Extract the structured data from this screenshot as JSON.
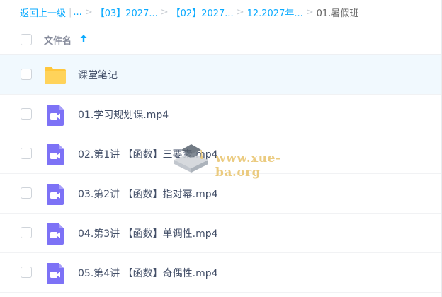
{
  "breadcrumb": {
    "back_label": "返回上一级",
    "separator_bar": "|",
    "ellipsis": "...",
    "chevron": ">",
    "items": [
      "【03】2027...",
      "【02】2027...",
      "12.2027年...",
      "01.暑假班"
    ]
  },
  "list": {
    "header_label": "文件名",
    "sort_icon": "arrow-up-icon",
    "files": [
      {
        "name": "课堂笔记",
        "icon": "folder-icon"
      },
      {
        "name": "01.学习规划课.mp4",
        "icon": "video-file-icon"
      },
      {
        "name": "02.第1讲 【函数】三要素.mp4",
        "icon": "video-file-icon"
      },
      {
        "name": "03.第2讲 【函数】指对幂.mp4",
        "icon": "video-file-icon"
      },
      {
        "name": "04.第3讲 【函数】单调性.mp4",
        "icon": "video-file-icon"
      },
      {
        "name": "05.第4讲 【函数】奇偶性.mp4",
        "icon": "video-file-icon"
      }
    ]
  },
  "watermark": {
    "text": "www.xue-ba.org"
  },
  "colors": {
    "link": "#09aaff",
    "folder": "#ffc73d",
    "video": "#7d72f6",
    "row_highlight": "#f1f9fe"
  }
}
